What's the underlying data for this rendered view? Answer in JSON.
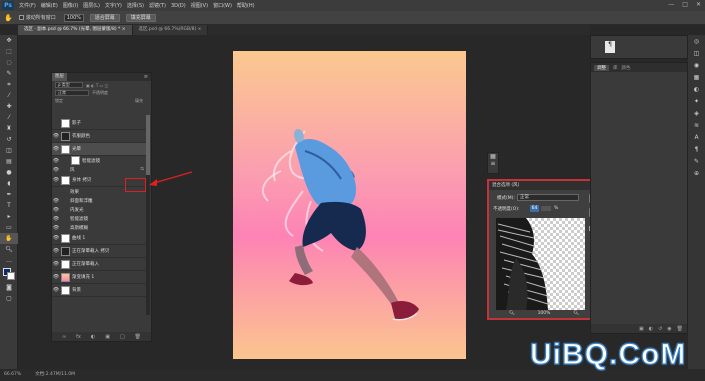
{
  "app": {
    "logo": "Ps",
    "menu": [
      "文件(F)",
      "编辑(E)",
      "图像(I)",
      "图层(L)",
      "文字(Y)",
      "选择(S)",
      "滤镜(T)",
      "3D(D)",
      "视图(V)",
      "窗口(W)",
      "帮助(H)"
    ],
    "window_controls": [
      "—",
      "□",
      "✕"
    ]
  },
  "options_bar": {
    "checkbox_label": "滚动所有窗口",
    "zoom_value": "100%",
    "fit_screen": "适合屏幕",
    "fill_screen": "填充屏幕"
  },
  "tabs": [
    {
      "label": "选区 · 副本.psd @ 66.7% (光晕, 图层蒙版/8) * ×",
      "active": true
    },
    {
      "label": "选区.psd @ 66.7%(RGB/8) ×",
      "active": false
    }
  ],
  "layers_panel": {
    "tab": "图层",
    "kind_dropdown": "ρ 类型",
    "blend_dropdown": "正常",
    "opacity_label": "不透明度",
    "lock_label": "锁定",
    "fill_label": "填充",
    "layers": [
      {
        "name": "影子",
        "thumb": "white",
        "eye": false
      },
      {
        "name": "衣服颜色",
        "thumb": "dark",
        "eye": true
      },
      {
        "name": "光晕",
        "thumb": "white",
        "eye": true,
        "selected": true
      },
      {
        "name": "智能滤镜",
        "thumb": "white",
        "eye": true,
        "sub": true
      },
      {
        "name": "风",
        "thumb": "",
        "eye": true,
        "sub": true,
        "fx": true
      },
      {
        "name": "身体 拷贝",
        "thumb": "white",
        "eye": true
      },
      {
        "name": "效果",
        "thumb": "",
        "eye": false,
        "sub": true
      },
      {
        "name": "斜面和浮雕",
        "thumb": "",
        "eye": true,
        "sub": true
      },
      {
        "name": "内发光",
        "thumb": "",
        "eye": true,
        "sub": true
      },
      {
        "name": "智能滤镜",
        "thumb": "",
        "eye": true,
        "sub": true
      },
      {
        "name": "高斯模糊",
        "thumb": "",
        "eye": true,
        "sub": true
      },
      {
        "name": "曲线 1",
        "thumb": "white",
        "eye": true
      },
      {
        "name": "正在渐晕载入 拷贝",
        "thumb": "dark",
        "eye": true
      },
      {
        "name": "正在渐晕载入",
        "thumb": "white",
        "eye": true
      },
      {
        "name": "渐变填充 1",
        "thumb": "grad",
        "eye": true
      },
      {
        "name": "背景",
        "thumb": "white",
        "eye": true
      }
    ],
    "footer_icons": [
      "∞",
      "fx",
      "◐",
      "▣",
      "□",
      "🗑"
    ]
  },
  "style_dialog": {
    "title": "混合选项 (风)",
    "mode_label": "模式(M):",
    "mode_value": "正常",
    "opacity_label": "不透明度(O):",
    "opacity_value": "64",
    "percent": "%",
    "ok": "确定",
    "cancel": "取消",
    "preview_label": "预览(P)",
    "zoom_value": "100%"
  },
  "right_panel": {
    "tabs": [
      "调整",
      "库",
      "颜色"
    ],
    "active_tab": "调整"
  },
  "status_bar": {
    "zoom": "66.67%",
    "doc": "文档:2.47M/11.0M"
  },
  "watermark": "UiBQ.CoM",
  "colors": {
    "accent_red": "#e02020",
    "ps_blue": "#4fa8e8"
  }
}
